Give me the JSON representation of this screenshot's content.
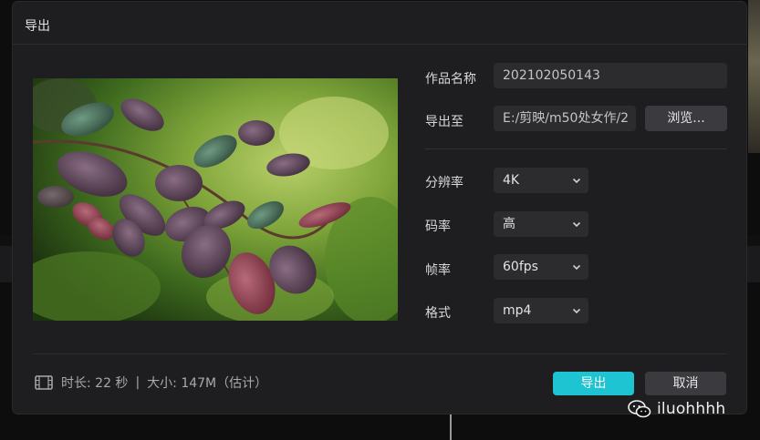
{
  "dialog": {
    "title": "导出"
  },
  "form": {
    "name_label": "作品名称",
    "name_value": "202102050143",
    "path_label": "导出至",
    "path_value": "E:/剪映/m50处女作/2",
    "browse_label": "浏览...",
    "resolution_label": "分辨率",
    "resolution_value": "4K",
    "bitrate_label": "码率",
    "bitrate_value": "高",
    "framerate_label": "帧率",
    "framerate_value": "60fps",
    "format_label": "格式",
    "format_value": "mp4"
  },
  "footer": {
    "duration": "时长: 22 秒",
    "separator": "|",
    "size": "大小: 147M（估计）",
    "export_label": "导出",
    "cancel_label": "取消"
  },
  "watermark": {
    "text": "iluohhhh"
  },
  "icons": {
    "film": "film-icon",
    "chevron": "chevron-down-icon",
    "wechat": "wechat-icon"
  },
  "colors": {
    "accent": "#1ec4d1",
    "dialog_bg": "#1e1e20",
    "field_bg": "#2c2c2f"
  }
}
